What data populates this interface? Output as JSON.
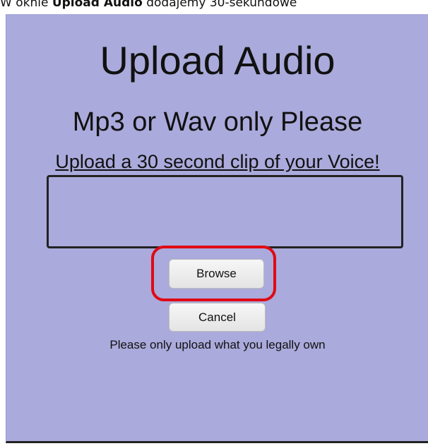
{
  "caption": {
    "prefix": "W oknie ",
    "bold": "Upload Audio",
    "suffix": " dodajemy 30-sekundowe"
  },
  "dialog": {
    "title": "Upload Audio",
    "subtitle": "Mp3 or Wav only Please",
    "instruction": "Upload a 30 second clip of your Voice!",
    "browse_label": "Browse",
    "cancel_label": "Cancel",
    "legal_note": "Please only upload what you legally own"
  },
  "colors": {
    "panel_background": "#aaaadc",
    "highlight": "#e00a14"
  }
}
